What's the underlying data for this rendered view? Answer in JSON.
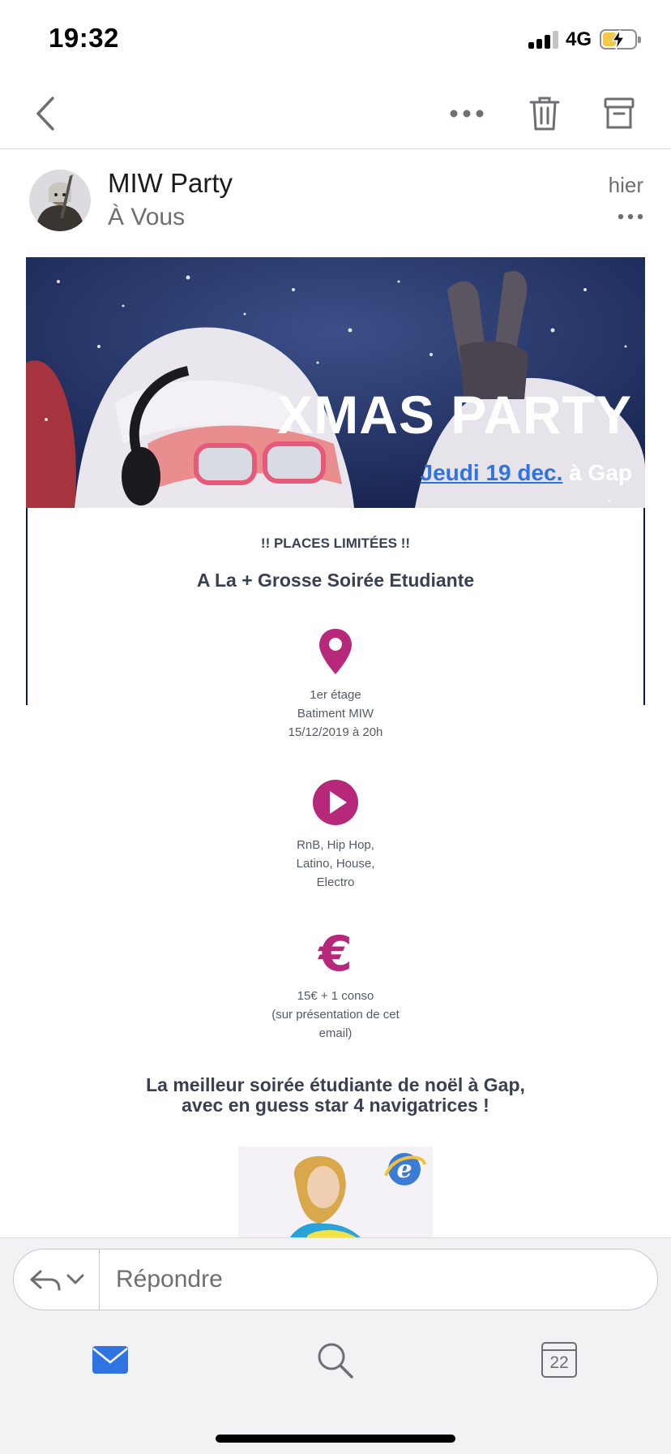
{
  "status_bar": {
    "time": "19:32",
    "network": "4G",
    "signal_bars": 3,
    "battery_level": 0.35,
    "charging": true
  },
  "nav": {
    "icons": [
      "chevron-left-icon",
      "more-horizontal-icon",
      "trash-icon",
      "archive-icon"
    ]
  },
  "email": {
    "sender": "MIW Party",
    "recipient": "À Vous",
    "date": "hier",
    "banner": {
      "title": "XMAS PARTY",
      "date_link": "Jeudi 19 dec.",
      "location_suffix": " à Gap"
    },
    "limited": "!! PLACES LIMITÉES !!",
    "subtitle": "A La + Grosse Soirée Etudiante",
    "info": [
      {
        "icon": "map-pin-icon",
        "text": "1er étage\nBatiment MIW\n15/12/2019 à 20h"
      },
      {
        "icon": "play-icon",
        "text": "RnB, Hip Hop,\nLatino, House,\nElectro"
      },
      {
        "icon": "euro-icon",
        "text": "15€ + 1 conso\n(sur présentation de cet\nemail)"
      }
    ],
    "tagline_line1": "La meilleur soirée étudiante de noël à Gap,",
    "tagline_line2": "avec en guess star 4 navigatrices !"
  },
  "reply": {
    "placeholder": "Répondre"
  },
  "tab_bar": {
    "tabs": [
      "mail-tab",
      "search-tab",
      "calendar-tab"
    ],
    "calendar_day": "22"
  },
  "colors": {
    "accent": "#2f74e0",
    "icon_magenta": "#b5287a",
    "banner_bg": "#1d2a5a",
    "body_text": "#3a3f52"
  }
}
